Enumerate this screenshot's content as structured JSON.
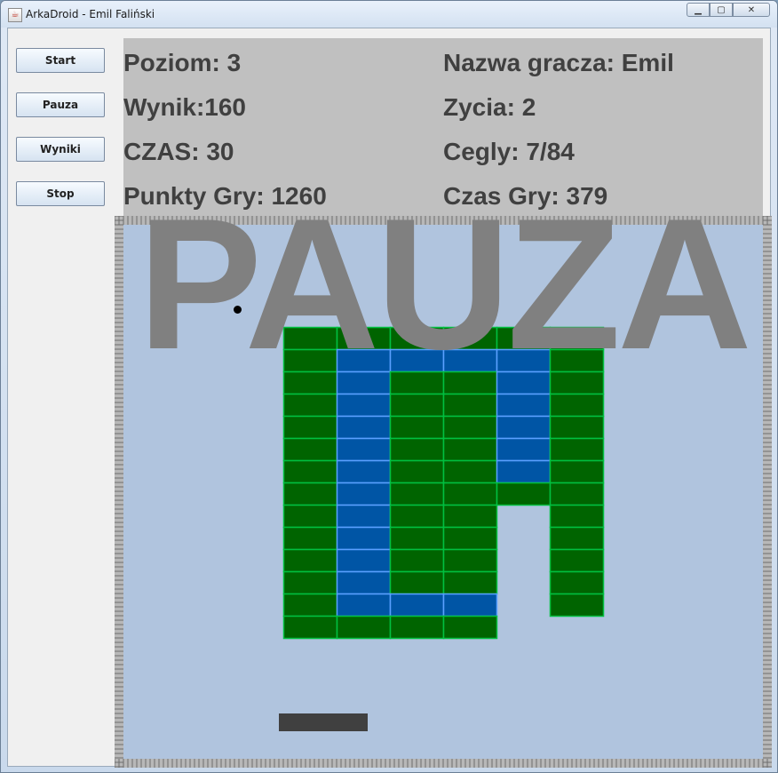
{
  "window": {
    "title": "ArkaDroid - Emil Faliński"
  },
  "buttons": {
    "start": "Start",
    "pause": "Pauza",
    "scores": "Wyniki",
    "stop": "Stop"
  },
  "stats": {
    "level": "Poziom: 3",
    "score": "Wynik:160",
    "time": "CZAS: 30",
    "game_points": "Punkty Gry: 1260",
    "player": "Nazwa gracza: Emil",
    "lives": "Zycia: 2",
    "bricks": "Cegly: 7/84",
    "game_time": "Czas Gry: 379"
  },
  "overlay": {
    "pause_text": "PAUZA"
  },
  "colors": {
    "field": "#b0c4de",
    "brick_green": "#006400",
    "brick_blue": "#0055a5",
    "brick_border_green": "#00c040",
    "brick_border_blue": "#5aa0ff",
    "paddle": "#404040",
    "overlay_text": "#808080"
  },
  "board": {
    "brick_rows": [
      "..GGGGGG.",
      "..GBBBBG.",
      "..GBGGBG.",
      "..GBGGBG.",
      "..GBGGBG.",
      "..GBGGBG.",
      "..GBGGBG.",
      "..GBGGGG.",
      "..GBGG.G.",
      "..GBGG.G.",
      "..GBGG.G.",
      "..GBGG.G.",
      "..GBBB.G.",
      "..GGGG..."
    ]
  }
}
